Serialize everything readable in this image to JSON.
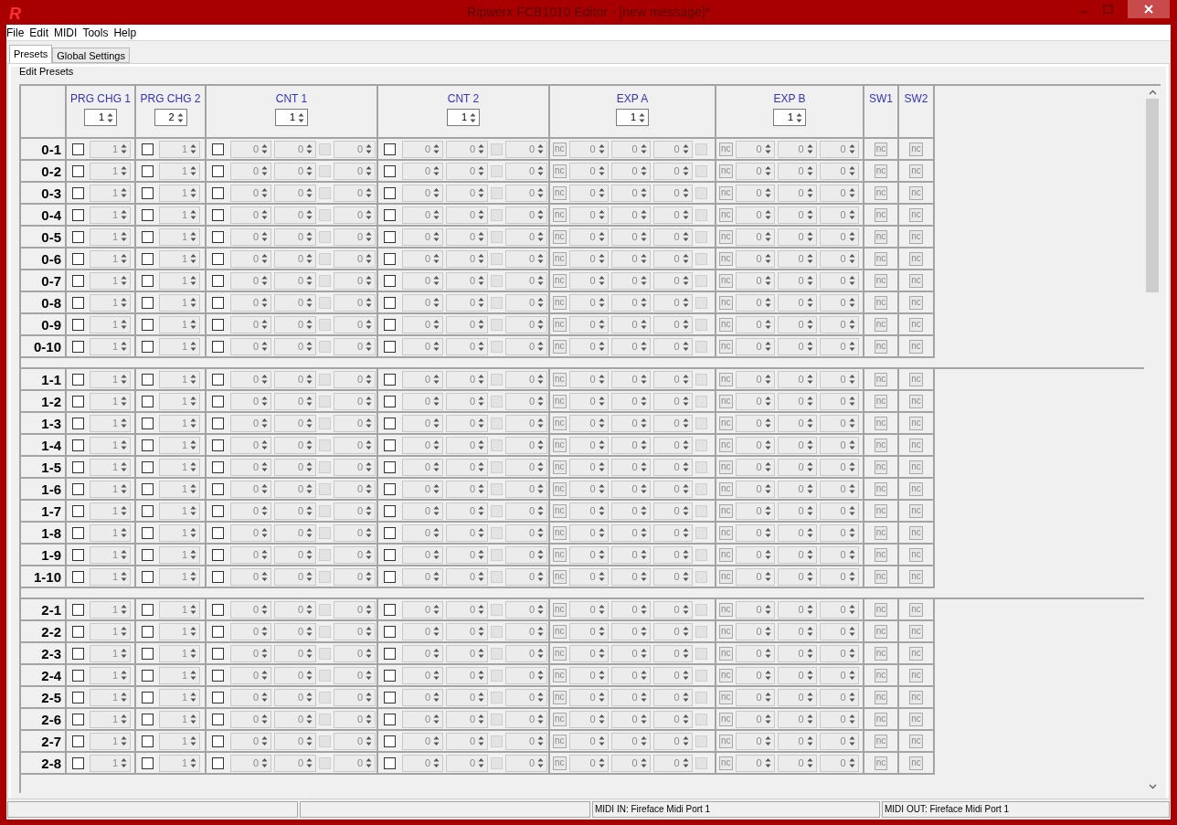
{
  "window": {
    "logo": "R",
    "title": "Ripwerx FCB1010 Editor - [new message]*"
  },
  "menu": [
    "File",
    "Edit",
    "MIDI",
    "Tools",
    "Help"
  ],
  "tabs": [
    {
      "label": "Presets",
      "selected": true
    },
    {
      "label": "Global Settings",
      "selected": false
    }
  ],
  "group_title": "Edit Presets",
  "columns": [
    {
      "title": "PRG CHG 1",
      "value": "1"
    },
    {
      "title": "PRG CHG 2",
      "value": "2"
    },
    {
      "title": "CNT 1",
      "value": "1"
    },
    {
      "title": "CNT 2",
      "value": "1"
    },
    {
      "title": "EXP A",
      "value": "1"
    },
    {
      "title": "EXP B",
      "value": "1"
    },
    {
      "title": "SW1"
    },
    {
      "title": "SW2"
    }
  ],
  "banks": [
    {
      "rows": [
        {
          "label": "0-1",
          "prg_chg_1": {
            "checked": false,
            "value": "1"
          },
          "prg_chg_2": {
            "checked": false,
            "value": "1"
          },
          "cnt_1": {
            "checked": false,
            "values": [
              "0",
              "0",
              "0"
            ],
            "option_checked": false
          },
          "cnt_2": {
            "checked": false,
            "values": [
              "0",
              "0",
              "0"
            ],
            "option_checked": false
          },
          "exp_a": {
            "button": "nc",
            "values": [
              "0",
              "0",
              "0"
            ],
            "option_checked": false
          },
          "exp_b": {
            "button": "nc",
            "values": [
              "0",
              "0",
              "0"
            ]
          },
          "sw1": "nc",
          "sw2": "nc"
        },
        {
          "label": "0-2",
          "prg_chg_1": {
            "checked": false,
            "value": "1"
          },
          "prg_chg_2": {
            "checked": false,
            "value": "1"
          },
          "cnt_1": {
            "checked": false,
            "values": [
              "0",
              "0",
              "0"
            ],
            "option_checked": false
          },
          "cnt_2": {
            "checked": false,
            "values": [
              "0",
              "0",
              "0"
            ],
            "option_checked": false
          },
          "exp_a": {
            "button": "nc",
            "values": [
              "0",
              "0",
              "0"
            ],
            "option_checked": false
          },
          "exp_b": {
            "button": "nc",
            "values": [
              "0",
              "0",
              "0"
            ]
          },
          "sw1": "nc",
          "sw2": "nc"
        },
        {
          "label": "0-3",
          "prg_chg_1": {
            "checked": false,
            "value": "1"
          },
          "prg_chg_2": {
            "checked": false,
            "value": "1"
          },
          "cnt_1": {
            "checked": false,
            "values": [
              "0",
              "0",
              "0"
            ],
            "option_checked": false
          },
          "cnt_2": {
            "checked": false,
            "values": [
              "0",
              "0",
              "0"
            ],
            "option_checked": false
          },
          "exp_a": {
            "button": "nc",
            "values": [
              "0",
              "0",
              "0"
            ],
            "option_checked": false
          },
          "exp_b": {
            "button": "nc",
            "values": [
              "0",
              "0",
              "0"
            ]
          },
          "sw1": "nc",
          "sw2": "nc"
        },
        {
          "label": "0-4",
          "prg_chg_1": {
            "checked": false,
            "value": "1"
          },
          "prg_chg_2": {
            "checked": false,
            "value": "1"
          },
          "cnt_1": {
            "checked": false,
            "values": [
              "0",
              "0",
              "0"
            ],
            "option_checked": false
          },
          "cnt_2": {
            "checked": false,
            "values": [
              "0",
              "0",
              "0"
            ],
            "option_checked": false
          },
          "exp_a": {
            "button": "nc",
            "values": [
              "0",
              "0",
              "0"
            ],
            "option_checked": false
          },
          "exp_b": {
            "button": "nc",
            "values": [
              "0",
              "0",
              "0"
            ]
          },
          "sw1": "nc",
          "sw2": "nc"
        },
        {
          "label": "0-5",
          "prg_chg_1": {
            "checked": false,
            "value": "1"
          },
          "prg_chg_2": {
            "checked": false,
            "value": "1"
          },
          "cnt_1": {
            "checked": false,
            "values": [
              "0",
              "0",
              "0"
            ],
            "option_checked": false
          },
          "cnt_2": {
            "checked": false,
            "values": [
              "0",
              "0",
              "0"
            ],
            "option_checked": false
          },
          "exp_a": {
            "button": "nc",
            "values": [
              "0",
              "0",
              "0"
            ],
            "option_checked": false
          },
          "exp_b": {
            "button": "nc",
            "values": [
              "0",
              "0",
              "0"
            ]
          },
          "sw1": "nc",
          "sw2": "nc"
        },
        {
          "label": "0-6",
          "prg_chg_1": {
            "checked": false,
            "value": "1"
          },
          "prg_chg_2": {
            "checked": false,
            "value": "1"
          },
          "cnt_1": {
            "checked": false,
            "values": [
              "0",
              "0",
              "0"
            ],
            "option_checked": false
          },
          "cnt_2": {
            "checked": false,
            "values": [
              "0",
              "0",
              "0"
            ],
            "option_checked": false
          },
          "exp_a": {
            "button": "nc",
            "values": [
              "0",
              "0",
              "0"
            ],
            "option_checked": false
          },
          "exp_b": {
            "button": "nc",
            "values": [
              "0",
              "0",
              "0"
            ]
          },
          "sw1": "nc",
          "sw2": "nc"
        },
        {
          "label": "0-7",
          "prg_chg_1": {
            "checked": false,
            "value": "1"
          },
          "prg_chg_2": {
            "checked": false,
            "value": "1"
          },
          "cnt_1": {
            "checked": false,
            "values": [
              "0",
              "0",
              "0"
            ],
            "option_checked": false
          },
          "cnt_2": {
            "checked": false,
            "values": [
              "0",
              "0",
              "0"
            ],
            "option_checked": false
          },
          "exp_a": {
            "button": "nc",
            "values": [
              "0",
              "0",
              "0"
            ],
            "option_checked": false
          },
          "exp_b": {
            "button": "nc",
            "values": [
              "0",
              "0",
              "0"
            ]
          },
          "sw1": "nc",
          "sw2": "nc"
        },
        {
          "label": "0-8",
          "prg_chg_1": {
            "checked": false,
            "value": "1"
          },
          "prg_chg_2": {
            "checked": false,
            "value": "1"
          },
          "cnt_1": {
            "checked": false,
            "values": [
              "0",
              "0",
              "0"
            ],
            "option_checked": false
          },
          "cnt_2": {
            "checked": false,
            "values": [
              "0",
              "0",
              "0"
            ],
            "option_checked": false
          },
          "exp_a": {
            "button": "nc",
            "values": [
              "0",
              "0",
              "0"
            ],
            "option_checked": false
          },
          "exp_b": {
            "button": "nc",
            "values": [
              "0",
              "0",
              "0"
            ]
          },
          "sw1": "nc",
          "sw2": "nc"
        },
        {
          "label": "0-9",
          "prg_chg_1": {
            "checked": false,
            "value": "1"
          },
          "prg_chg_2": {
            "checked": false,
            "value": "1"
          },
          "cnt_1": {
            "checked": false,
            "values": [
              "0",
              "0",
              "0"
            ],
            "option_checked": false
          },
          "cnt_2": {
            "checked": false,
            "values": [
              "0",
              "0",
              "0"
            ],
            "option_checked": false
          },
          "exp_a": {
            "button": "nc",
            "values": [
              "0",
              "0",
              "0"
            ],
            "option_checked": false
          },
          "exp_b": {
            "button": "nc",
            "values": [
              "0",
              "0",
              "0"
            ]
          },
          "sw1": "nc",
          "sw2": "nc"
        },
        {
          "label": "0-10",
          "prg_chg_1": {
            "checked": false,
            "value": "1"
          },
          "prg_chg_2": {
            "checked": false,
            "value": "1"
          },
          "cnt_1": {
            "checked": false,
            "values": [
              "0",
              "0",
              "0"
            ],
            "option_checked": false
          },
          "cnt_2": {
            "checked": false,
            "values": [
              "0",
              "0",
              "0"
            ],
            "option_checked": false
          },
          "exp_a": {
            "button": "nc",
            "values": [
              "0",
              "0",
              "0"
            ],
            "option_checked": false
          },
          "exp_b": {
            "button": "nc",
            "values": [
              "0",
              "0",
              "0"
            ]
          },
          "sw1": "nc",
          "sw2": "nc"
        }
      ]
    },
    {
      "rows": [
        {
          "label": "1-1",
          "prg_chg_1": {
            "checked": false,
            "value": "1"
          },
          "prg_chg_2": {
            "checked": false,
            "value": "1"
          },
          "cnt_1": {
            "checked": false,
            "values": [
              "0",
              "0",
              "0"
            ],
            "option_checked": false
          },
          "cnt_2": {
            "checked": false,
            "values": [
              "0",
              "0",
              "0"
            ],
            "option_checked": false
          },
          "exp_a": {
            "button": "nc",
            "values": [
              "0",
              "0",
              "0"
            ],
            "option_checked": false
          },
          "exp_b": {
            "button": "nc",
            "values": [
              "0",
              "0",
              "0"
            ]
          },
          "sw1": "nc",
          "sw2": "nc"
        },
        {
          "label": "1-2",
          "prg_chg_1": {
            "checked": false,
            "value": "1"
          },
          "prg_chg_2": {
            "checked": false,
            "value": "1"
          },
          "cnt_1": {
            "checked": false,
            "values": [
              "0",
              "0",
              "0"
            ],
            "option_checked": false
          },
          "cnt_2": {
            "checked": false,
            "values": [
              "0",
              "0",
              "0"
            ],
            "option_checked": false
          },
          "exp_a": {
            "button": "nc",
            "values": [
              "0",
              "0",
              "0"
            ],
            "option_checked": false
          },
          "exp_b": {
            "button": "nc",
            "values": [
              "0",
              "0",
              "0"
            ]
          },
          "sw1": "nc",
          "sw2": "nc"
        },
        {
          "label": "1-3",
          "prg_chg_1": {
            "checked": false,
            "value": "1"
          },
          "prg_chg_2": {
            "checked": false,
            "value": "1"
          },
          "cnt_1": {
            "checked": false,
            "values": [
              "0",
              "0",
              "0"
            ],
            "option_checked": false
          },
          "cnt_2": {
            "checked": false,
            "values": [
              "0",
              "0",
              "0"
            ],
            "option_checked": false
          },
          "exp_a": {
            "button": "nc",
            "values": [
              "0",
              "0",
              "0"
            ],
            "option_checked": false
          },
          "exp_b": {
            "button": "nc",
            "values": [
              "0",
              "0",
              "0"
            ]
          },
          "sw1": "nc",
          "sw2": "nc"
        },
        {
          "label": "1-4",
          "prg_chg_1": {
            "checked": false,
            "value": "1"
          },
          "prg_chg_2": {
            "checked": false,
            "value": "1"
          },
          "cnt_1": {
            "checked": false,
            "values": [
              "0",
              "0",
              "0"
            ],
            "option_checked": false
          },
          "cnt_2": {
            "checked": false,
            "values": [
              "0",
              "0",
              "0"
            ],
            "option_checked": false
          },
          "exp_a": {
            "button": "nc",
            "values": [
              "0",
              "0",
              "0"
            ],
            "option_checked": false
          },
          "exp_b": {
            "button": "nc",
            "values": [
              "0",
              "0",
              "0"
            ]
          },
          "sw1": "nc",
          "sw2": "nc"
        },
        {
          "label": "1-5",
          "prg_chg_1": {
            "checked": false,
            "value": "1"
          },
          "prg_chg_2": {
            "checked": false,
            "value": "1"
          },
          "cnt_1": {
            "checked": false,
            "values": [
              "0",
              "0",
              "0"
            ],
            "option_checked": false
          },
          "cnt_2": {
            "checked": false,
            "values": [
              "0",
              "0",
              "0"
            ],
            "option_checked": false
          },
          "exp_a": {
            "button": "nc",
            "values": [
              "0",
              "0",
              "0"
            ],
            "option_checked": false
          },
          "exp_b": {
            "button": "nc",
            "values": [
              "0",
              "0",
              "0"
            ]
          },
          "sw1": "nc",
          "sw2": "nc"
        },
        {
          "label": "1-6",
          "prg_chg_1": {
            "checked": false,
            "value": "1"
          },
          "prg_chg_2": {
            "checked": false,
            "value": "1"
          },
          "cnt_1": {
            "checked": false,
            "values": [
              "0",
              "0",
              "0"
            ],
            "option_checked": false
          },
          "cnt_2": {
            "checked": false,
            "values": [
              "0",
              "0",
              "0"
            ],
            "option_checked": false
          },
          "exp_a": {
            "button": "nc",
            "values": [
              "0",
              "0",
              "0"
            ],
            "option_checked": false
          },
          "exp_b": {
            "button": "nc",
            "values": [
              "0",
              "0",
              "0"
            ]
          },
          "sw1": "nc",
          "sw2": "nc"
        },
        {
          "label": "1-7",
          "prg_chg_1": {
            "checked": false,
            "value": "1"
          },
          "prg_chg_2": {
            "checked": false,
            "value": "1"
          },
          "cnt_1": {
            "checked": false,
            "values": [
              "0",
              "0",
              "0"
            ],
            "option_checked": false
          },
          "cnt_2": {
            "checked": false,
            "values": [
              "0",
              "0",
              "0"
            ],
            "option_checked": false
          },
          "exp_a": {
            "button": "nc",
            "values": [
              "0",
              "0",
              "0"
            ],
            "option_checked": false
          },
          "exp_b": {
            "button": "nc",
            "values": [
              "0",
              "0",
              "0"
            ]
          },
          "sw1": "nc",
          "sw2": "nc"
        },
        {
          "label": "1-8",
          "prg_chg_1": {
            "checked": false,
            "value": "1"
          },
          "prg_chg_2": {
            "checked": false,
            "value": "1"
          },
          "cnt_1": {
            "checked": false,
            "values": [
              "0",
              "0",
              "0"
            ],
            "option_checked": false
          },
          "cnt_2": {
            "checked": false,
            "values": [
              "0",
              "0",
              "0"
            ],
            "option_checked": false
          },
          "exp_a": {
            "button": "nc",
            "values": [
              "0",
              "0",
              "0"
            ],
            "option_checked": false
          },
          "exp_b": {
            "button": "nc",
            "values": [
              "0",
              "0",
              "0"
            ]
          },
          "sw1": "nc",
          "sw2": "nc"
        },
        {
          "label": "1-9",
          "prg_chg_1": {
            "checked": false,
            "value": "1"
          },
          "prg_chg_2": {
            "checked": false,
            "value": "1"
          },
          "cnt_1": {
            "checked": false,
            "values": [
              "0",
              "0",
              "0"
            ],
            "option_checked": false
          },
          "cnt_2": {
            "checked": false,
            "values": [
              "0",
              "0",
              "0"
            ],
            "option_checked": false
          },
          "exp_a": {
            "button": "nc",
            "values": [
              "0",
              "0",
              "0"
            ],
            "option_checked": false
          },
          "exp_b": {
            "button": "nc",
            "values": [
              "0",
              "0",
              "0"
            ]
          },
          "sw1": "nc",
          "sw2": "nc"
        },
        {
          "label": "1-10",
          "prg_chg_1": {
            "checked": false,
            "value": "1"
          },
          "prg_chg_2": {
            "checked": false,
            "value": "1"
          },
          "cnt_1": {
            "checked": false,
            "values": [
              "0",
              "0",
              "0"
            ],
            "option_checked": false
          },
          "cnt_2": {
            "checked": false,
            "values": [
              "0",
              "0",
              "0"
            ],
            "option_checked": false
          },
          "exp_a": {
            "button": "nc",
            "values": [
              "0",
              "0",
              "0"
            ],
            "option_checked": false
          },
          "exp_b": {
            "button": "nc",
            "values": [
              "0",
              "0",
              "0"
            ]
          },
          "sw1": "nc",
          "sw2": "nc"
        }
      ]
    },
    {
      "rows": [
        {
          "label": "2-1",
          "prg_chg_1": {
            "checked": false,
            "value": "1"
          },
          "prg_chg_2": {
            "checked": false,
            "value": "1"
          },
          "cnt_1": {
            "checked": false,
            "values": [
              "0",
              "0",
              "0"
            ],
            "option_checked": false
          },
          "cnt_2": {
            "checked": false,
            "values": [
              "0",
              "0",
              "0"
            ],
            "option_checked": false
          },
          "exp_a": {
            "button": "nc",
            "values": [
              "0",
              "0",
              "0"
            ],
            "option_checked": false
          },
          "exp_b": {
            "button": "nc",
            "values": [
              "0",
              "0",
              "0"
            ]
          },
          "sw1": "nc",
          "sw2": "nc"
        },
        {
          "label": "2-2",
          "prg_chg_1": {
            "checked": false,
            "value": "1"
          },
          "prg_chg_2": {
            "checked": false,
            "value": "1"
          },
          "cnt_1": {
            "checked": false,
            "values": [
              "0",
              "0",
              "0"
            ],
            "option_checked": false
          },
          "cnt_2": {
            "checked": false,
            "values": [
              "0",
              "0",
              "0"
            ],
            "option_checked": false
          },
          "exp_a": {
            "button": "nc",
            "values": [
              "0",
              "0",
              "0"
            ],
            "option_checked": false
          },
          "exp_b": {
            "button": "nc",
            "values": [
              "0",
              "0",
              "0"
            ]
          },
          "sw1": "nc",
          "sw2": "nc"
        },
        {
          "label": "2-3",
          "prg_chg_1": {
            "checked": false,
            "value": "1"
          },
          "prg_chg_2": {
            "checked": false,
            "value": "1"
          },
          "cnt_1": {
            "checked": false,
            "values": [
              "0",
              "0",
              "0"
            ],
            "option_checked": false
          },
          "cnt_2": {
            "checked": false,
            "values": [
              "0",
              "0",
              "0"
            ],
            "option_checked": false
          },
          "exp_a": {
            "button": "nc",
            "values": [
              "0",
              "0",
              "0"
            ],
            "option_checked": false
          },
          "exp_b": {
            "button": "nc",
            "values": [
              "0",
              "0",
              "0"
            ]
          },
          "sw1": "nc",
          "sw2": "nc"
        },
        {
          "label": "2-4",
          "prg_chg_1": {
            "checked": false,
            "value": "1"
          },
          "prg_chg_2": {
            "checked": false,
            "value": "1"
          },
          "cnt_1": {
            "checked": false,
            "values": [
              "0",
              "0",
              "0"
            ],
            "option_checked": false
          },
          "cnt_2": {
            "checked": false,
            "values": [
              "0",
              "0",
              "0"
            ],
            "option_checked": false
          },
          "exp_a": {
            "button": "nc",
            "values": [
              "0",
              "0",
              "0"
            ],
            "option_checked": false
          },
          "exp_b": {
            "button": "nc",
            "values": [
              "0",
              "0",
              "0"
            ]
          },
          "sw1": "nc",
          "sw2": "nc"
        },
        {
          "label": "2-5",
          "prg_chg_1": {
            "checked": false,
            "value": "1"
          },
          "prg_chg_2": {
            "checked": false,
            "value": "1"
          },
          "cnt_1": {
            "checked": false,
            "values": [
              "0",
              "0",
              "0"
            ],
            "option_checked": false
          },
          "cnt_2": {
            "checked": false,
            "values": [
              "0",
              "0",
              "0"
            ],
            "option_checked": false
          },
          "exp_a": {
            "button": "nc",
            "values": [
              "0",
              "0",
              "0"
            ],
            "option_checked": false
          },
          "exp_b": {
            "button": "nc",
            "values": [
              "0",
              "0",
              "0"
            ]
          },
          "sw1": "nc",
          "sw2": "nc"
        },
        {
          "label": "2-6",
          "prg_chg_1": {
            "checked": false,
            "value": "1"
          },
          "prg_chg_2": {
            "checked": false,
            "value": "1"
          },
          "cnt_1": {
            "checked": false,
            "values": [
              "0",
              "0",
              "0"
            ],
            "option_checked": false
          },
          "cnt_2": {
            "checked": false,
            "values": [
              "0",
              "0",
              "0"
            ],
            "option_checked": false
          },
          "exp_a": {
            "button": "nc",
            "values": [
              "0",
              "0",
              "0"
            ],
            "option_checked": false
          },
          "exp_b": {
            "button": "nc",
            "values": [
              "0",
              "0",
              "0"
            ]
          },
          "sw1": "nc",
          "sw2": "nc"
        },
        {
          "label": "2-7",
          "prg_chg_1": {
            "checked": false,
            "value": "1"
          },
          "prg_chg_2": {
            "checked": false,
            "value": "1"
          },
          "cnt_1": {
            "checked": false,
            "values": [
              "0",
              "0",
              "0"
            ],
            "option_checked": false
          },
          "cnt_2": {
            "checked": false,
            "values": [
              "0",
              "0",
              "0"
            ],
            "option_checked": false
          },
          "exp_a": {
            "button": "nc",
            "values": [
              "0",
              "0",
              "0"
            ],
            "option_checked": false
          },
          "exp_b": {
            "button": "nc",
            "values": [
              "0",
              "0",
              "0"
            ]
          },
          "sw1": "nc",
          "sw2": "nc"
        },
        {
          "label": "2-8",
          "prg_chg_1": {
            "checked": false,
            "value": "1"
          },
          "prg_chg_2": {
            "checked": false,
            "value": "1"
          },
          "cnt_1": {
            "checked": false,
            "values": [
              "0",
              "0",
              "0"
            ],
            "option_checked": false
          },
          "cnt_2": {
            "checked": false,
            "values": [
              "0",
              "0",
              "0"
            ],
            "option_checked": false
          },
          "exp_a": {
            "button": "nc",
            "values": [
              "0",
              "0",
              "0"
            ],
            "option_checked": false
          },
          "exp_b": {
            "button": "nc",
            "values": [
              "0",
              "0",
              "0"
            ]
          },
          "sw1": "nc",
          "sw2": "nc"
        }
      ]
    }
  ],
  "status_bar": [
    {
      "kind": "blank"
    },
    {
      "kind": "blank"
    },
    {
      "kind": "text",
      "text": "MIDI IN: Fireface Midi Port 1"
    },
    {
      "kind": "text",
      "text": "MIDI OUT: Fireface Midi Port 1"
    }
  ]
}
